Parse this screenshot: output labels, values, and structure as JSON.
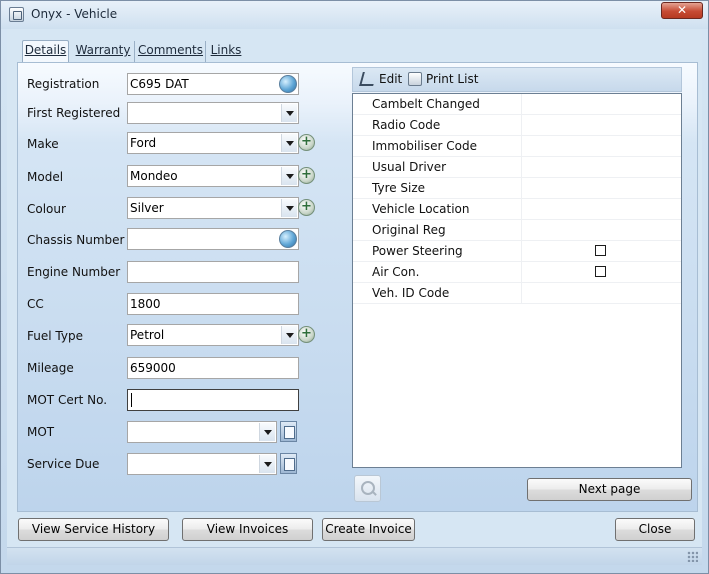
{
  "window": {
    "title": "Onyx - Vehicle",
    "close_glyph": "✕"
  },
  "tabs": [
    {
      "label": "Details",
      "active": true
    },
    {
      "label": "Warranty",
      "active": false
    },
    {
      "label": "Comments",
      "active": false
    },
    {
      "label": "Links",
      "active": false
    }
  ],
  "form": {
    "registration": {
      "label": "Registration",
      "value": "C695 DAT"
    },
    "first_registered": {
      "label": "First Registered",
      "value": ""
    },
    "make": {
      "label": "Make",
      "value": "Ford"
    },
    "model": {
      "label": "Model",
      "value": "Mondeo"
    },
    "colour": {
      "label": "Colour",
      "value": "Silver"
    },
    "chassis_number": {
      "label": "Chassis Number",
      "value": ""
    },
    "engine_number": {
      "label": "Engine Number",
      "value": ""
    },
    "cc": {
      "label": "CC",
      "value": "1800"
    },
    "fuel_type": {
      "label": "Fuel Type",
      "value": "Petrol"
    },
    "mileage": {
      "label": "Mileage",
      "value": "659000"
    },
    "mot_cert_no": {
      "label": "MOT Cert No.",
      "value": ""
    },
    "mot": {
      "label": "MOT",
      "value": ""
    },
    "service_due": {
      "label": "Service Due",
      "value": ""
    }
  },
  "right_panel": {
    "toolbar": {
      "edit_label": "Edit",
      "print_list_label": "Print List"
    },
    "rows": [
      {
        "label": "Cambelt Changed",
        "checkbox": false
      },
      {
        "label": "Radio Code",
        "checkbox": false
      },
      {
        "label": "Immobiliser Code",
        "checkbox": false
      },
      {
        "label": "Usual Driver",
        "checkbox": false
      },
      {
        "label": "Tyre Size",
        "checkbox": false
      },
      {
        "label": "Vehicle Location",
        "checkbox": false
      },
      {
        "label": "Original Reg",
        "checkbox": false
      },
      {
        "label": "Power Steering",
        "checkbox": true,
        "checked": false
      },
      {
        "label": "Air Con.",
        "checkbox": true,
        "checked": false
      },
      {
        "label": "Veh. ID Code",
        "checkbox": false
      }
    ]
  },
  "buttons": {
    "next_page": "Next page",
    "view_service_history": "View Service History",
    "view_invoices": "View Invoices",
    "create_invoice": "Create Invoice",
    "close": "Close"
  },
  "icons": {
    "window": "window-icon",
    "globe": "globe-icon",
    "plus": "plus-icon",
    "calendar": "calendar-icon",
    "search": "search-icon",
    "edit": "edit-icon",
    "print": "print-icon"
  }
}
